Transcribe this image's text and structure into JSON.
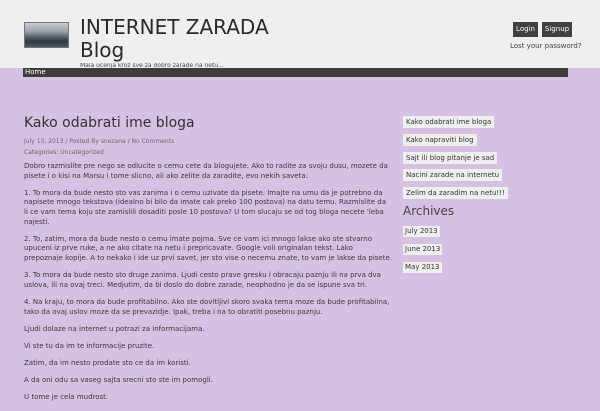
{
  "header": {
    "site_title_line1": "INTERNET ZARADA",
    "site_title_line2": "Blog",
    "tagline": "Mala ucenja kroz sve za dobro zarade na netu...",
    "login_label": "Login",
    "signup_label": "Signup",
    "lost_password": "Lost your password?"
  },
  "nav": {
    "home": "Home"
  },
  "post": {
    "title": "Kako odabrati ime bloga",
    "meta": "July 13, 2013 / Posted By snezana / No Comments",
    "categories": "Categories: Uncategorized",
    "paragraphs": [
      "Dobro razmislite pre nego se odlucite o cemu cete da blogujete. Ako to radite za svoju dusu, mozete da pisete i o kisi na Marsu i tome slicno, ali ako zelite da zaradite, evo nekih saveta:",
      "1. To mora da bude nesto sto vas zanima i o cemu uzivate da pisete. Imajte na umu da je potrebno da napisete mnogo tekstova (idealno bi bilo da imate cak preko 100 postova) na datu temu. Razmislite da li ce vam tema koju ste zamislili dosaditi posle 10 postova? U tom slucaju se od tog bloga necete 'leba najesti.",
      "2. To, zatim, mora da bude nesto o cemu imate pojma. Sve ce vam ici mnogo lakse ako ste stvarno upuceni iz prve ruke, a ne ako citate na netu i prepricavate. Google voli originalan tekst. Lako prepoznaje kopije. A to nekako i ide uz prvi savet, jer sto vise o necemu znate, to vam je lakse da pisete.",
      "3. To mora da bude nesto sto druge zanima. Ljudi cesto prave gresku i obracaju paznju ili na prva dva uslova, ili na ovaj treci. Medjutim, da bi doslo do dobre zarade, neophodno je da se ispune sva tri.",
      "4. Na kraju, to mora da bude profitabilno. Ako ste dovitljivi skoro svaka tema moze da bude profitabilna, tako da ovaj uslov moze da se prevazidje. Ipak, treba i na to obratiti posebnu paznju.",
      "Ljudi dolaze na internet u potrazi za informacijama.",
      "Vi ste tu da im te informacije pruzite.",
      "Zatim, da im nesto prodate sto ce da im koristi.",
      "A da oni odu sa vaseg sajta srecni sto ste im pomogli.",
      "U tome je cela mudrost."
    ]
  },
  "sidebar": {
    "links": [
      "Kako odabrati ime bloga",
      "Kako napraviti blog",
      "Sajt ili blog pitanje je sad",
      "Nacini zarade na internetu",
      "Zelim da zaradim na netu!!!"
    ],
    "archives_title": "Archives",
    "archives": [
      "July 2013",
      "June 2013",
      "May 2013"
    ]
  },
  "colors": {
    "background": "#d6c0e3",
    "header": "#efefef",
    "navbar": "#3d3d3d"
  }
}
